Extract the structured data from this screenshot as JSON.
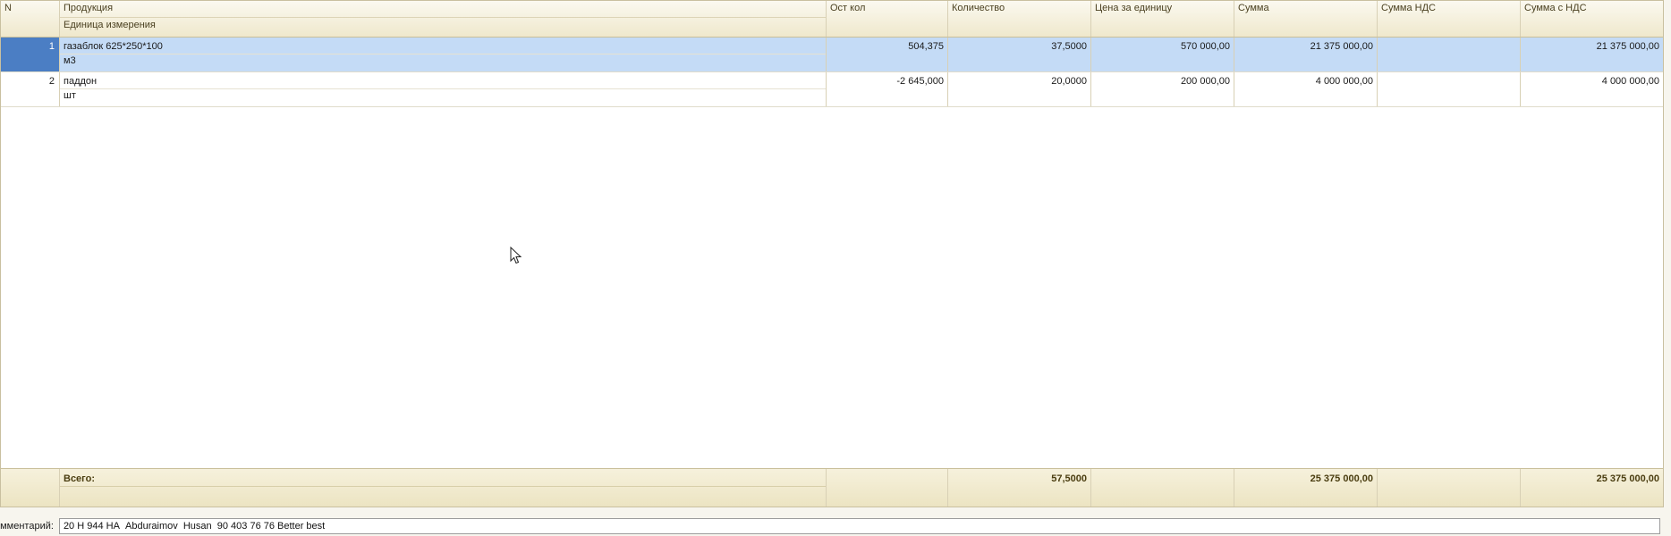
{
  "columns": {
    "n": "N",
    "product": "Продукция",
    "unit": "Единица измерения",
    "stock": "Ост кол",
    "quantity": "Количество",
    "price": "Цена за единицу",
    "sum": "Сумма",
    "vat_sum": "Сумма НДС",
    "sum_with_vat": "Сумма с НДС"
  },
  "rows": [
    {
      "n": "1",
      "product": "газаблок 625*250*100",
      "unit": "м3",
      "stock": "504,375",
      "quantity": "37,5000",
      "price": "570 000,00",
      "sum": "21 375 000,00",
      "vat_sum": "",
      "sum_with_vat": "21 375 000,00",
      "selected": true
    },
    {
      "n": "2",
      "product": "паддон",
      "unit": "шт",
      "stock": "-2 645,000",
      "quantity": "20,0000",
      "price": "200 000,00",
      "sum": "4 000 000,00",
      "vat_sum": "",
      "sum_with_vat": "4 000 000,00",
      "selected": false
    }
  ],
  "totals": {
    "label": "Всего:",
    "quantity": "57,5000",
    "sum": "25 375 000,00",
    "sum_with_vat": "25 375 000,00"
  },
  "comment": {
    "label": "омментарий:",
    "value": "20 Н 944 НА  Abduraimov  Husan  90 403 76 76 Better best"
  },
  "colors": {
    "selected_row": "#c4dbf6",
    "selected_number": "#4b7ec4",
    "header_bg": "#efe8cc"
  }
}
